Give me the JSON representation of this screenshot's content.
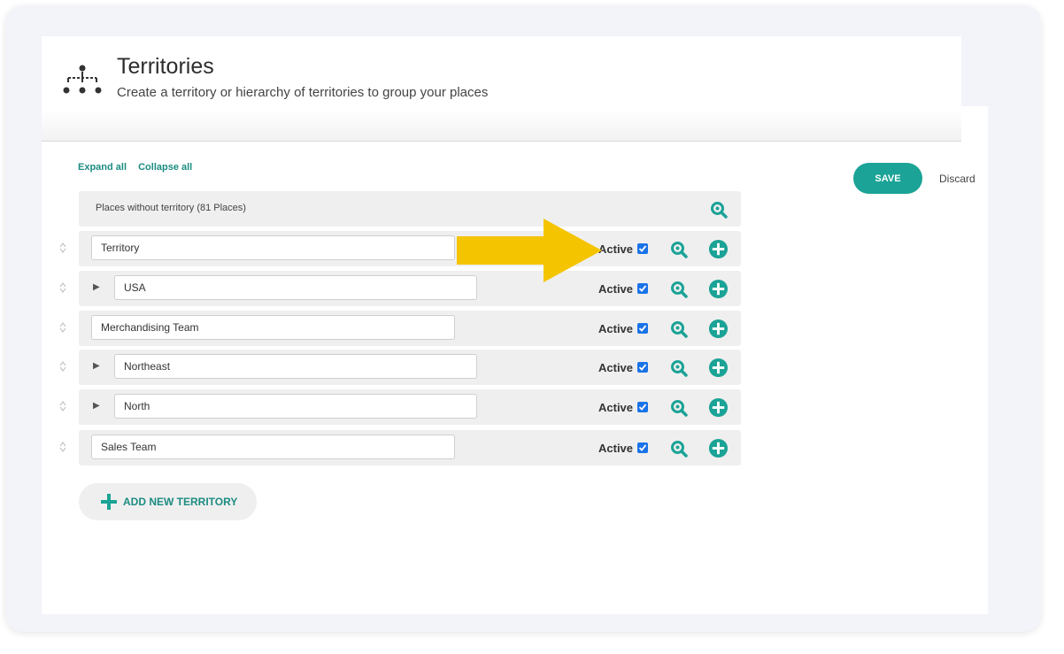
{
  "header": {
    "title": "Territories",
    "subtitle": "Create a territory or hierarchy of territories to group your places",
    "icon": "hierarchy-icon"
  },
  "tree_actions": {
    "expand_all": "Expand all",
    "collapse_all": "Collapse all"
  },
  "actions": {
    "save": "SAVE",
    "discard": "Discard"
  },
  "places_without_territory": "Places without territory (81 Places)",
  "rows": [
    {
      "name": "Territory",
      "expandable": false,
      "active_label": "Active",
      "active": true
    },
    {
      "name": "USA",
      "expandable": true,
      "active_label": "Active",
      "active": true
    },
    {
      "name": "Merchandising Team",
      "expandable": false,
      "active_label": "Active",
      "active": true
    },
    {
      "name": "Northeast",
      "expandable": true,
      "active_label": "Active",
      "active": true
    },
    {
      "name": "North",
      "expandable": true,
      "active_label": "Active",
      "active": true
    },
    {
      "name": "Sales Team",
      "expandable": false,
      "active_label": "Active",
      "active": true
    }
  ],
  "add_new_territory": "ADD NEW TERRITORY",
  "colors": {
    "accent": "#1aa396",
    "checkbox": "#1a73e8",
    "annotation_arrow": "#f5c400"
  }
}
